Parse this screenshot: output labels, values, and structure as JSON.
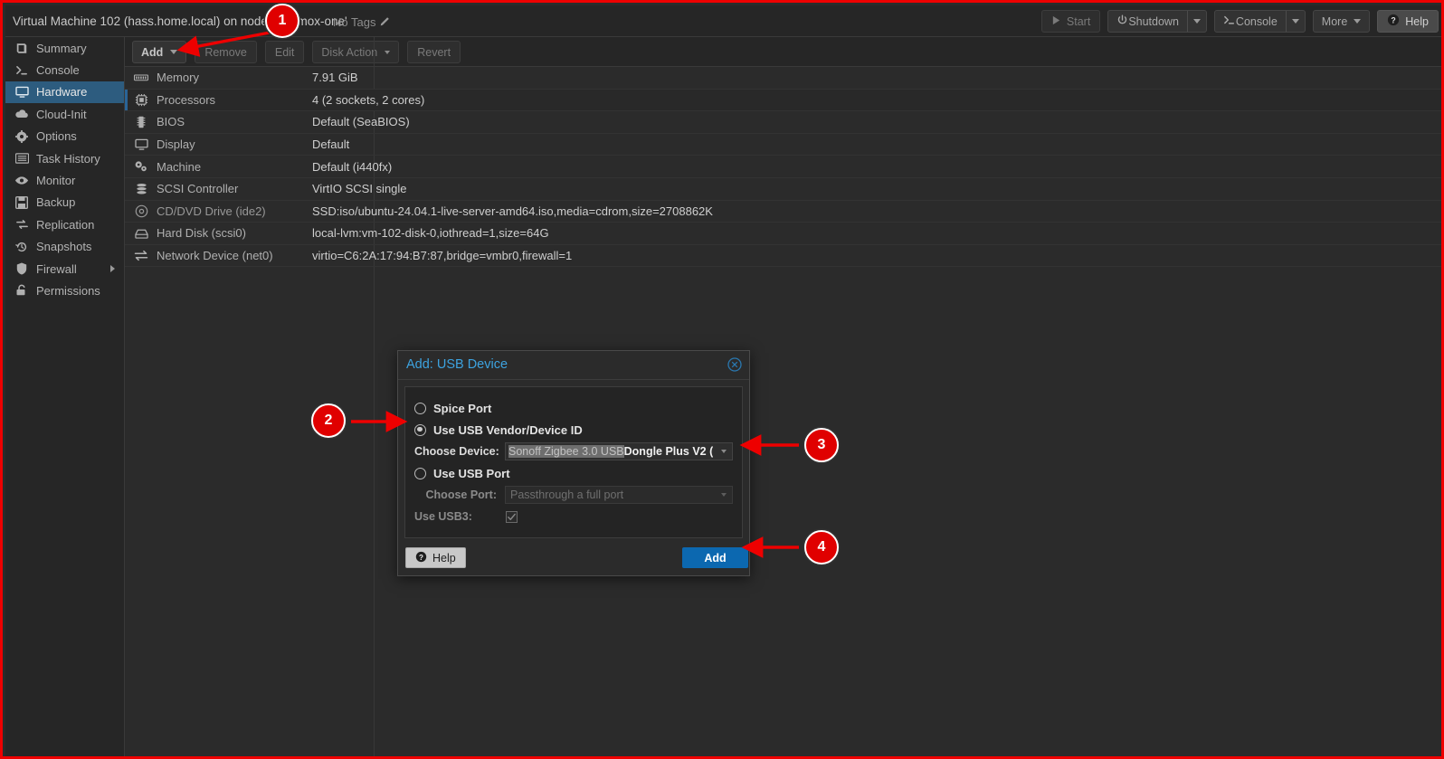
{
  "header": {
    "title": "Virtual Machine 102 (hass.home.local) on node 'proxmox-one'",
    "tags_label": "No Tags",
    "buttons": [
      {
        "label": "Start",
        "icon": "play-icon",
        "disabled": true,
        "split": false
      },
      {
        "label": "Shutdown",
        "icon": "power-icon",
        "disabled": false,
        "split": true
      },
      {
        "label": "Console",
        "icon": "terminal-icon",
        "disabled": false,
        "split": true
      },
      {
        "label": "More",
        "icon": "none",
        "disabled": false,
        "split": true
      },
      {
        "label": "Help",
        "icon": "question-icon",
        "disabled": false,
        "split": false
      }
    ]
  },
  "sidebar": {
    "items": [
      {
        "label": "Summary",
        "icon": "book-icon",
        "active": false,
        "arrow": false
      },
      {
        "label": "Console",
        "icon": "terminal-icon",
        "active": false,
        "arrow": false
      },
      {
        "label": "Hardware",
        "icon": "monitor-icon",
        "active": true,
        "arrow": false
      },
      {
        "label": "Cloud-Init",
        "icon": "cloud-icon",
        "active": false,
        "arrow": false
      },
      {
        "label": "Options",
        "icon": "gear-icon",
        "active": false,
        "arrow": false
      },
      {
        "label": "Task History",
        "icon": "list-icon",
        "active": false,
        "arrow": false
      },
      {
        "label": "Monitor",
        "icon": "eye-icon",
        "active": false,
        "arrow": false
      },
      {
        "label": "Backup",
        "icon": "floppy-icon",
        "active": false,
        "arrow": false
      },
      {
        "label": "Replication",
        "icon": "replication-icon",
        "active": false,
        "arrow": false
      },
      {
        "label": "Snapshots",
        "icon": "history-icon",
        "active": false,
        "arrow": false
      },
      {
        "label": "Firewall",
        "icon": "shield-icon",
        "active": false,
        "arrow": true
      },
      {
        "label": "Permissions",
        "icon": "lock-icon",
        "active": false,
        "arrow": false
      }
    ]
  },
  "content_toolbar": {
    "buttons": [
      {
        "label": "Add",
        "split": true,
        "disabled": false
      },
      {
        "label": "Remove",
        "split": false,
        "disabled": true
      },
      {
        "label": "Edit",
        "split": false,
        "disabled": true
      },
      {
        "label": "Disk Action",
        "split": true,
        "disabled": true
      },
      {
        "label": "Revert",
        "split": false,
        "disabled": true
      }
    ]
  },
  "hardware_table": {
    "rows": [
      {
        "icon": "memory-icon",
        "key": "Memory",
        "value": "7.91 GiB",
        "marked": false
      },
      {
        "icon": "cpu-icon",
        "key": "Processors",
        "value": "4 (2 sockets, 2 cores)",
        "marked": true
      },
      {
        "icon": "bios-icon",
        "key": "BIOS",
        "value": "Default (SeaBIOS)",
        "marked": false
      },
      {
        "icon": "monitor-icon",
        "key": "Display",
        "value": "Default",
        "marked": false
      },
      {
        "icon": "gears-icon",
        "key": "Machine",
        "value": "Default (i440fx)",
        "marked": false
      },
      {
        "icon": "database-icon",
        "key": "SCSI Controller",
        "value": "VirtIO SCSI single",
        "marked": false
      },
      {
        "icon": "cd-icon",
        "key": "CD/DVD Drive (ide2)",
        "value": "SSD:iso/ubuntu-24.04.1-live-server-amd64.iso,media=cdrom,size=2708862K",
        "marked": false
      },
      {
        "icon": "harddisk-icon",
        "key": "Hard Disk (scsi0)",
        "value": "local-lvm:vm-102-disk-0,iothread=1,size=64G",
        "marked": false
      },
      {
        "icon": "network-icon",
        "key": "Network Device (net0)",
        "value": "virtio=C6:2A:17:94:B7:87,bridge=vmbr0,firewall=1",
        "marked": false
      }
    ]
  },
  "dialog": {
    "title_prefix": "Add",
    "title_suffix": ": USB Device",
    "title": "Add: USB Device",
    "options": {
      "spice_port_label": "Spice Port",
      "spice_port_selected": false,
      "vendor_id_label": "Use USB Vendor/Device ID",
      "vendor_id_selected": true,
      "usb_port_label": "Use USB Port",
      "usb_port_selected": false
    },
    "choose_device": {
      "label": "Choose Device:",
      "value_selected_part": "Sonoff Zigbee 3.0 USB",
      "value_rest_part": "Dongle Plus V2 (",
      "full_value": "Sonoff Zigbee 3.0 USB Dongle Plus V2 ("
    },
    "choose_port": {
      "label": "Choose Port:",
      "placeholder": "Passthrough a full port",
      "disabled": true
    },
    "use_usb3": {
      "label": "Use USB3:",
      "checked": true,
      "disabled": true
    },
    "footer": {
      "help_label": "Help",
      "add_label": "Add"
    }
  },
  "annotations": {
    "markers": [
      {
        "number": "1"
      },
      {
        "number": "2"
      },
      {
        "number": "3"
      },
      {
        "number": "4"
      }
    ],
    "accent_color": "#e00000"
  },
  "colors": {
    "accent_blue": "#0c68b0",
    "sidebar_active": "#2d5c7f",
    "dialog_title": "#3da3e0",
    "annotation_red": "#e00000",
    "border_red": "#ee0000"
  }
}
